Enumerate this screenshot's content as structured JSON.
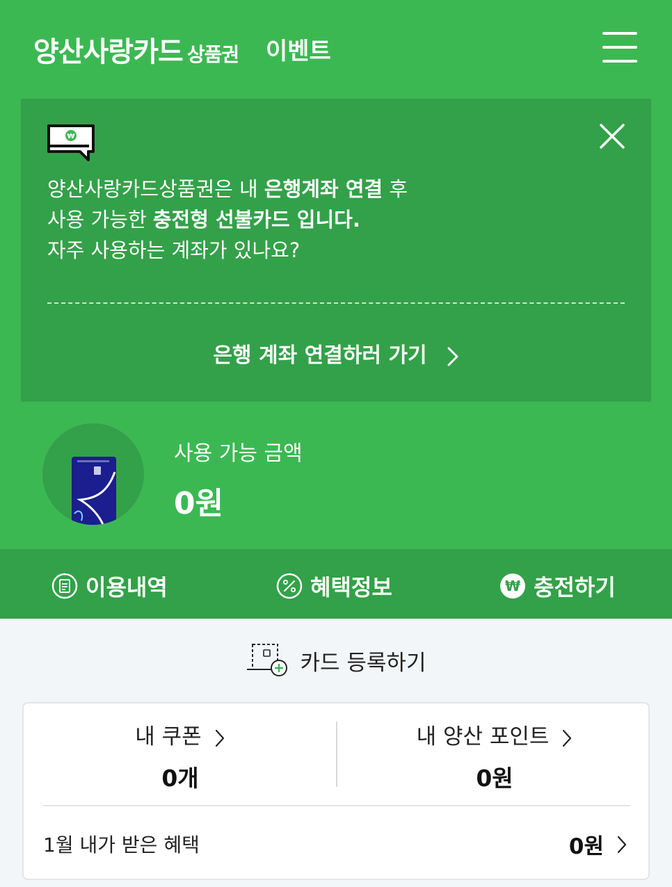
{
  "header": {
    "brand": "양산사랑카드",
    "brand_sub": "상품권",
    "event": "이벤트"
  },
  "notice": {
    "line1_normal": "양산사랑카드상품권은 내 ",
    "line1_bold": "은행계좌 연결",
    "line1_end": " 후",
    "line2_normal": "사용 가능한 ",
    "line2_bold": "충전형 선불카드 입니다.",
    "line3": "자주 사용하는 계좌가 있나요?",
    "link": "은행 계좌 연결하러 가기"
  },
  "balance": {
    "label": "사용 가능 금액",
    "value": "0원"
  },
  "actions": {
    "history": "이용내역",
    "benefit": "혜택정보",
    "charge": "충전하기"
  },
  "register": {
    "label": "카드 등록하기"
  },
  "summary": {
    "coupon_title": "내 쿠폰",
    "coupon_value": "0개",
    "point_title": "내 양산 포인트",
    "point_value": "0원",
    "month_label": "1월  내가 받은 혜택",
    "month_value": "0원"
  },
  "colors": {
    "primary_green": "#3cb853",
    "dark_green": "#33a149",
    "card_blue": "#1a1e8e"
  }
}
